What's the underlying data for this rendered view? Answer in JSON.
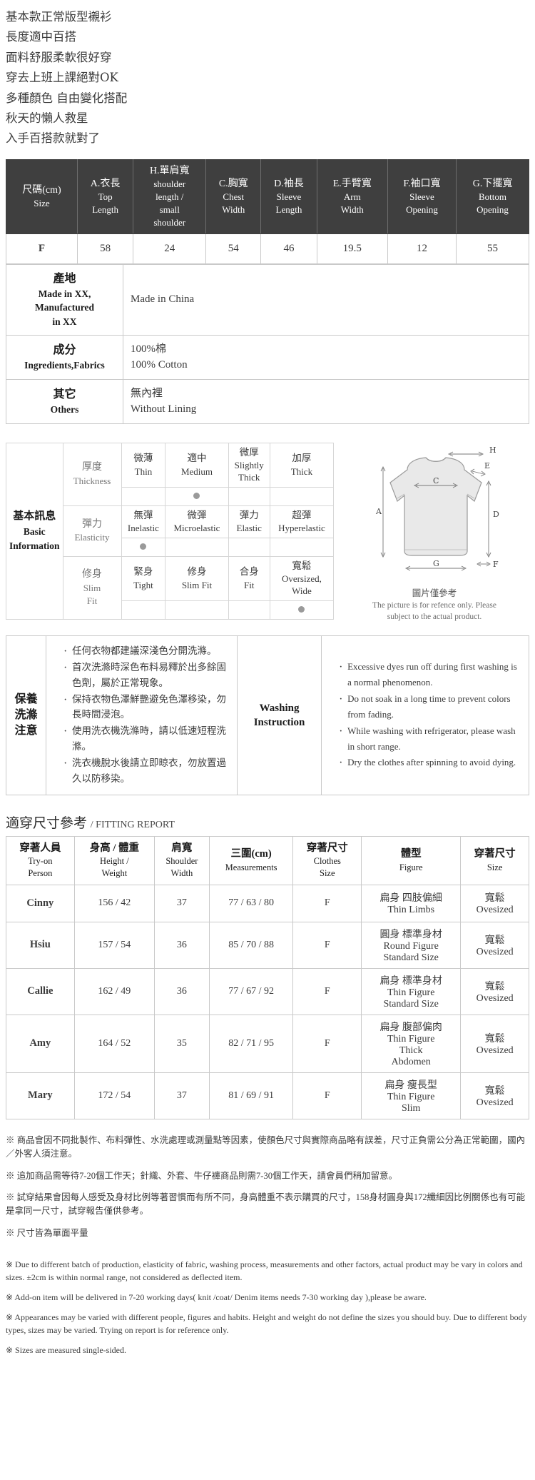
{
  "intro": {
    "lines": [
      "基本款正常版型襯衫",
      "長度適中百搭",
      "面料舒服柔軟很好穿",
      "穿去上班上課絕對OK",
      "多種顏色 自由變化搭配",
      "秋天的懶人救星",
      "入手百搭款就對了"
    ]
  },
  "size_table": {
    "headers": [
      {
        "cn": "尺碼(cm)",
        "en": "Size"
      },
      {
        "cn": "A.衣長",
        "en": "Top\nLength"
      },
      {
        "cn": "H.單肩寬",
        "en": "shoulder\nlength /\nsmall\nshoulder"
      },
      {
        "cn": "C.胸寬",
        "en": "Chest\nWidth"
      },
      {
        "cn": "D.袖長",
        "en": "Sleeve\nLength"
      },
      {
        "cn": "E.手臂寬",
        "en": "Arm\nWidth"
      },
      {
        "cn": "F.袖口寬",
        "en": "Sleeve\nOpening"
      },
      {
        "cn": "G.下擺寬",
        "en": "Bottom\nOpening"
      }
    ],
    "rows": [
      {
        "size": "F",
        "values": [
          "58",
          "24",
          "54",
          "46",
          "19.5",
          "12",
          "55"
        ]
      }
    ]
  },
  "info_rows": [
    {
      "label_cn": "產地",
      "label_en": "Made in XX,\nManufactured\nin XX",
      "value_cn": "Made in China",
      "value_en": ""
    },
    {
      "label_cn": "成分",
      "label_en": "Ingredients,Fabrics",
      "value_cn": "100%棉",
      "value_en": "100% Cotton"
    },
    {
      "label_cn": "其它",
      "label_en": "Others",
      "value_cn": "無內裡",
      "value_en": "Without Lining"
    }
  ],
  "basic_info": {
    "title_cn": "基本訊息",
    "title_en": "Basic\nInformation",
    "rows": [
      {
        "label_cn": "厚度",
        "label_en": "Thickness",
        "options": [
          {
            "cn": "微薄",
            "en": "Thin",
            "selected": false
          },
          {
            "cn": "適中",
            "en": "Medium",
            "selected": true
          },
          {
            "cn": "微厚",
            "en": "Slightly\nThick",
            "selected": false
          },
          {
            "cn": "加厚",
            "en": "Thick",
            "selected": false
          }
        ]
      },
      {
        "label_cn": "彈力",
        "label_en": "Elasticity",
        "options": [
          {
            "cn": "無彈",
            "en": "Inelastic",
            "selected": true
          },
          {
            "cn": "微彈",
            "en": "Microelastic",
            "selected": false
          },
          {
            "cn": "彈力",
            "en": "Elastic",
            "selected": false
          },
          {
            "cn": "超彈",
            "en": "Hyperelastic",
            "selected": false
          }
        ]
      },
      {
        "label_cn": "修身",
        "label_en": "Slim\nFit",
        "options": [
          {
            "cn": "緊身",
            "en": "Tight",
            "selected": false
          },
          {
            "cn": "修身",
            "en": "Slim Fit",
            "selected": false
          },
          {
            "cn": "合身",
            "en": "Fit",
            "selected": false
          },
          {
            "cn": "寬鬆",
            "en": "Oversized,\nWide",
            "selected": true
          }
        ]
      }
    ]
  },
  "diagram": {
    "labels": [
      "A",
      "C",
      "D",
      "E",
      "F",
      "G",
      "H"
    ],
    "caption_cn": "圖片僅參考",
    "caption_en": "The picture is for refence only. Please\nsubject to the actual product."
  },
  "washing": {
    "label_cn": "保養\n洗滌\n注意",
    "label_en": "Washing\nInstruction",
    "items_cn": [
      "任何衣物都建議深淺色分開洗滌。",
      "首次洗滌時深色布料易釋於出多餘固色劑，屬於正常現象。",
      "保持衣物色澤鮮艷避免色澤移染，勿長時間浸泡。",
      "使用洗衣機洗滌時，請以低速短程洗滌。",
      "洗衣機脫水後請立即晾衣，勿放置過久以防移染。"
    ],
    "items_en": [
      "Excessive dyes run off during first washing is a normal phenomenon.",
      "Do not soak in a long time to prevent colors from fading.",
      "While washing with refrigerator, please wash in short range.",
      "Dry the clothes after spinning to avoid dying."
    ]
  },
  "fitting_report": {
    "title_cn": "適穿尺寸參考",
    "title_en": "/ FITTING REPORT",
    "headers": [
      {
        "cn": "穿著人員",
        "en": "Try-on\nPerson"
      },
      {
        "cn": "身高 / 體重",
        "en": "Height /\nWeight"
      },
      {
        "cn": "肩寬",
        "en": "Shoulder\nWidth"
      },
      {
        "cn": "三圍(cm)",
        "en": "Measurements"
      },
      {
        "cn": "穿著尺寸",
        "en": "Clothes\nSize"
      },
      {
        "cn": "體型",
        "en": "Figure"
      },
      {
        "cn": "穿著尺寸",
        "en": "Size"
      }
    ],
    "rows": [
      {
        "name": "Cinny",
        "height_weight": "156 / 42",
        "shoulder": "37",
        "measurements": "77 / 63 / 80",
        "clothes_size": "F",
        "figure_cn": "扁身 四肢偏細",
        "figure_en": "Thin Limbs",
        "figure_en2": "",
        "size_cn": "寬鬆",
        "size_en": "Ovesized"
      },
      {
        "name": "Hsiu",
        "height_weight": "157 / 54",
        "shoulder": "36",
        "measurements": "85 / 70 / 88",
        "clothes_size": "F",
        "figure_cn": "圓身 標準身材",
        "figure_en": "Round Figure",
        "figure_en2": "Standard Size",
        "size_cn": "寬鬆",
        "size_en": "Ovesized"
      },
      {
        "name": "Callie",
        "height_weight": "162 / 49",
        "shoulder": "36",
        "measurements": "77 / 67 / 92",
        "clothes_size": "F",
        "figure_cn": "扁身 標準身材",
        "figure_en": "Thin Figure",
        "figure_en2": "Standard Size",
        "size_cn": "寬鬆",
        "size_en": "Ovesized"
      },
      {
        "name": "Amy",
        "height_weight": "164 / 52",
        "shoulder": "35",
        "measurements": "82 / 71 / 95",
        "clothes_size": "F",
        "figure_cn": "扁身 腹部偏肉",
        "figure_en": "Thin Figure",
        "figure_en2": "Thick\nAbdomen",
        "size_cn": "寬鬆",
        "size_en": "Ovesized"
      },
      {
        "name": "Mary",
        "height_weight": "172 / 54",
        "shoulder": "37",
        "measurements": "81 / 69 / 91",
        "clothes_size": "F",
        "figure_cn": "扁身 瘦長型",
        "figure_en": "Thin Figure",
        "figure_en2": "Slim",
        "size_cn": "寬鬆",
        "size_en": "Ovesized"
      }
    ]
  },
  "notes": {
    "cn": [
      "※ 商品會因不同批製作、布料彈性、水洗處理或測量點等因素，使顏色尺寸與實際商品略有誤差，尺寸正負需公分為正常範圍，國內／外客人須注意。",
      "※ 追加商品需等待7-20個工作天；針織、外套、牛仔褲商品則需7-30個工作天，請會員們稍加留意。",
      "※ 試穿結果會因每人感受及身材比例等著習慣而有所不同，身高體重不表示購買的尺寸，158身材圓身與172纖細因比例關係也有可能是拿同一尺寸，試穿報告僅供參考。",
      "※ 尺寸皆為單面平量"
    ],
    "en": [
      "※ Due to different batch of production, elasticity of fabric, washing process, measurements and other factors, actual product may be vary in colors and sizes. ±2cm is within normal range, not considered as deflected item.",
      "※ Add-on item will be delivered in 7-20 working days( knit /coat/ Denim items needs 7-30 working day ),please be aware.",
      "※ Appearances may be varied with different people, figures and habits. Height and weight do not define the sizes you should buy. Due to different body types, sizes may be varied. Trying on report is for reference only.",
      "※ Sizes are measured single-sided."
    ]
  }
}
